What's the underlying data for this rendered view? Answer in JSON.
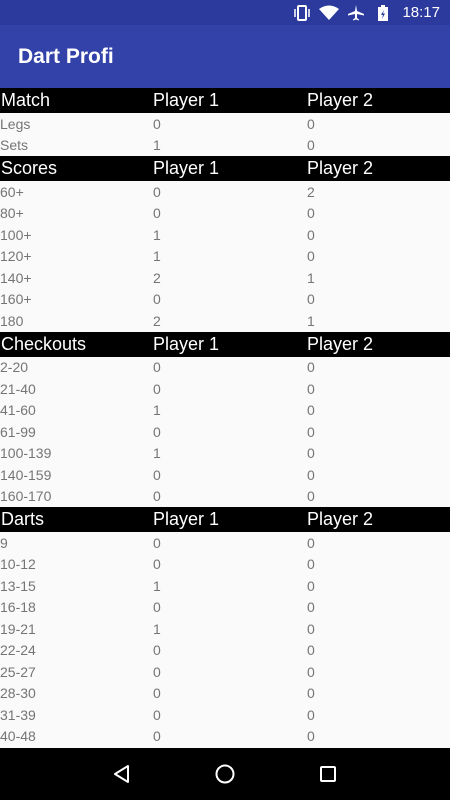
{
  "status_bar": {
    "time": "18:17",
    "icons": [
      "vibrate-icon",
      "wifi-icon",
      "airplane-icon",
      "battery-icon"
    ]
  },
  "app_bar": {
    "title": "Dart Profi"
  },
  "sections": [
    {
      "name": "match",
      "headers": [
        "Match",
        "Player 1",
        "Player 2"
      ],
      "rows": [
        [
          "Legs",
          "0",
          "0"
        ],
        [
          "Sets",
          "1",
          "0"
        ]
      ]
    },
    {
      "name": "scores",
      "headers": [
        "Scores",
        "Player 1",
        "Player 2"
      ],
      "rows": [
        [
          "60+",
          "0",
          "2"
        ],
        [
          "80+",
          "0",
          "0"
        ],
        [
          "100+",
          "1",
          "0"
        ],
        [
          "120+",
          "1",
          "0"
        ],
        [
          "140+",
          "2",
          "1"
        ],
        [
          "160+",
          "0",
          "0"
        ],
        [
          "180",
          "2",
          "1"
        ]
      ]
    },
    {
      "name": "checkouts",
      "headers": [
        "Checkouts",
        "Player 1",
        "Player 2"
      ],
      "rows": [
        [
          "2-20",
          "0",
          "0"
        ],
        [
          "21-40",
          "0",
          "0"
        ],
        [
          "41-60",
          "1",
          "0"
        ],
        [
          "61-99",
          "0",
          "0"
        ],
        [
          "100-139",
          "1",
          "0"
        ],
        [
          "140-159",
          "0",
          "0"
        ],
        [
          "160-170",
          "0",
          "0"
        ]
      ]
    },
    {
      "name": "darts",
      "headers": [
        "Darts",
        "Player 1",
        "Player 2"
      ],
      "rows": [
        [
          "9",
          "0",
          "0"
        ],
        [
          "10-12",
          "0",
          "0"
        ],
        [
          "13-15",
          "1",
          "0"
        ],
        [
          "16-18",
          "0",
          "0"
        ],
        [
          "19-21",
          "1",
          "0"
        ],
        [
          "22-24",
          "0",
          "0"
        ],
        [
          "25-27",
          "0",
          "0"
        ],
        [
          "28-30",
          "0",
          "0"
        ],
        [
          "31-39",
          "0",
          "0"
        ],
        [
          "40-48",
          "0",
          "0"
        ]
      ]
    }
  ],
  "nav_bar": {
    "buttons": [
      "back-icon",
      "home-icon",
      "recents-icon"
    ]
  },
  "colors": {
    "status_bar": "#2b3a9c",
    "app_bar": "#3342a8",
    "section_header": "#000000",
    "row_text": "#757575",
    "background": "#fafafa"
  }
}
